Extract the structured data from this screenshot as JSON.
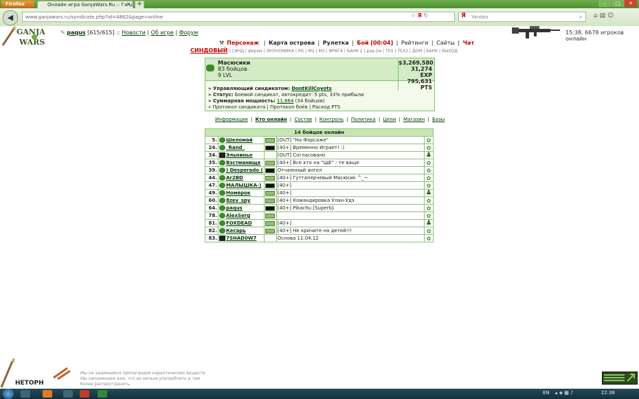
{
  "browser": {
    "firefox_label": "Firefox",
    "tab_title": "Онлайн игра GanjaWars.Ru :: Ганджуба...",
    "url": "www.ganjawars.ru/syndicate.php?id=4862&page=online",
    "search_placeholder": "Yandex",
    "yandex_logo": "Я"
  },
  "header": {
    "username": "paqus",
    "hp": "[615/615]",
    "sep": "::",
    "links": [
      "Новости",
      "Об игре",
      "Форум"
    ],
    "time_online": "15:38, 6678 игроков онлайн"
  },
  "main_nav": [
    {
      "label": "Персонаж",
      "style": "red"
    },
    {
      "label": "Карта острова",
      "style": "b"
    },
    {
      "label": "Рулетка",
      "style": "b"
    },
    {
      "label": "Бой [00:04]",
      "style": "red"
    },
    {
      "label": "Рейтинги",
      "style": ""
    },
    {
      "label": "Сайты",
      "style": ""
    },
    {
      "label": "Чат",
      "style": "red"
    }
  ],
  "sub_nav": {
    "current": "СИНДОВЫЙ",
    "items": [
      "СИНД",
      "ферма",
      "ЭКОНОМИКА",
      "М1",
      "М2",
      "М3",
      "ФРАГА",
      "БАНК 2",
      "рэд-2м",
      "ТЕХ",
      "ТЕХ2",
      "ДОМ",
      "БАНК",
      "ВЫХОД"
    ]
  },
  "syndicate": {
    "name": "Масюсики",
    "fighters": "83 бойцов",
    "level": "9 LVL",
    "money": "$3,269,580",
    "exp": "31,274 EXP",
    "pts": "795,631 PTS",
    "manager_label": "» Управляющий синдикатом:",
    "manager_name": "DontKillCoyots",
    "status_label": "» Статус:",
    "status_text": "Боевой синдикат, автокредит: 5 pts, 33% прибыли",
    "power_label": "» Суммарная мощность:",
    "power_value": "11,664",
    "power_note": "(34 бойцов)",
    "protocol_prefix": "» Протокол синдиката",
    "protocol_fights": "Протокол боёв",
    "protocol_pts": "Расход PTS"
  },
  "tabs": [
    {
      "label": "Информация",
      "active": false
    },
    {
      "label": "Кто онлайн",
      "active": true
    },
    {
      "label": "Состав",
      "active": false
    },
    {
      "label": "Контроль",
      "active": false
    },
    {
      "label": "Политика",
      "active": false
    },
    {
      "label": "Цели",
      "active": false
    },
    {
      "label": "Магазин",
      "active": false
    },
    {
      "label": "Базы",
      "active": false
    }
  ],
  "roster": {
    "title": "14 бойцов онлайн",
    "rows": [
      {
        "num": "5.",
        "nick": "Шеломай",
        "battery": "full",
        "status": "[OUT] \"На Форсаже\"",
        "icon": "leaf",
        "clan": "ball"
      },
      {
        "num": "24.",
        "nick": "_Rand_",
        "battery": "empty",
        "status": "[40+] Временно Играет! :)",
        "icon": "leaf",
        "clan": "ball"
      },
      {
        "num": "34.",
        "nick": "Эльниньо",
        "battery": "none",
        "status": "[OUT] Согласовано",
        "icon": "person",
        "clan": "env"
      },
      {
        "num": "35.",
        "nick": "Вэстманище",
        "battery": "full",
        "status": "[40+] Все кто на \"ЩЕ\" - те ваще",
        "icon": "leaf",
        "clan": "ball"
      },
      {
        "num": "39.",
        "nick": ") Desperado (",
        "battery": "empty",
        "status": "Отчаянный ангел",
        "icon": "leaf",
        "clan": "ball"
      },
      {
        "num": "44.",
        "nick": "Ar2BD",
        "battery": "full",
        "status": "[40+] Гуттаперчевый Масюсик ^_~",
        "icon": "leaf",
        "clan": "ball"
      },
      {
        "num": "47.",
        "nick": "МАЛЫШКА-)",
        "battery": "empty",
        "status": "[40+]",
        "icon": "leaf",
        "clan": "ball"
      },
      {
        "num": "49.",
        "nick": "Номерок",
        "battery": "full",
        "status": "[40+]",
        "icon": "person",
        "clan": "ball"
      },
      {
        "num": "60.",
        "nick": "8zev_spy",
        "battery": "full",
        "status": "[40+] Командировка Улан-Удэ",
        "icon": "leaf",
        "clan": "ball"
      },
      {
        "num": "64.",
        "nick": "paqus",
        "battery": "empty",
        "status": "[40+] Pikachu [Superb]",
        "icon": "leaf",
        "clan": "ball"
      },
      {
        "num": "78.",
        "nick": "AlexSerg",
        "battery": "full",
        "status": "",
        "icon": "leaf",
        "clan": "ball"
      },
      {
        "num": "81.",
        "nick": "FOXDEAD",
        "battery": "full",
        "status": "[40+]",
        "icon": "person",
        "clan": "ball"
      },
      {
        "num": "82.",
        "nick": "Кесарь",
        "battery": "full",
        "status": "[40+] Не кричите на детей!!!",
        "icon": "leaf",
        "clan": "ball"
      },
      {
        "num": "83.",
        "nick": "7SHAD0W7",
        "battery": "none",
        "status": "Основа 11.04.12",
        "icon": "leaf",
        "clan": "env"
      }
    ]
  },
  "footer": {
    "disclaimer": [
      "Мы не занимаемся пропагандой наркотических веществ.",
      "Мы напоминаем вам, что их нельзя употреблять и тем",
      "более распространять."
    ],
    "hetorn": "НЕТОРН"
  },
  "taskbar": {
    "lang": "EN",
    "clock": "22:38"
  },
  "colors": {
    "accent_green": "#7fbf6a",
    "header_green": "#d4ecc6",
    "link_green": "#004400",
    "alert_red": "#b00000"
  }
}
